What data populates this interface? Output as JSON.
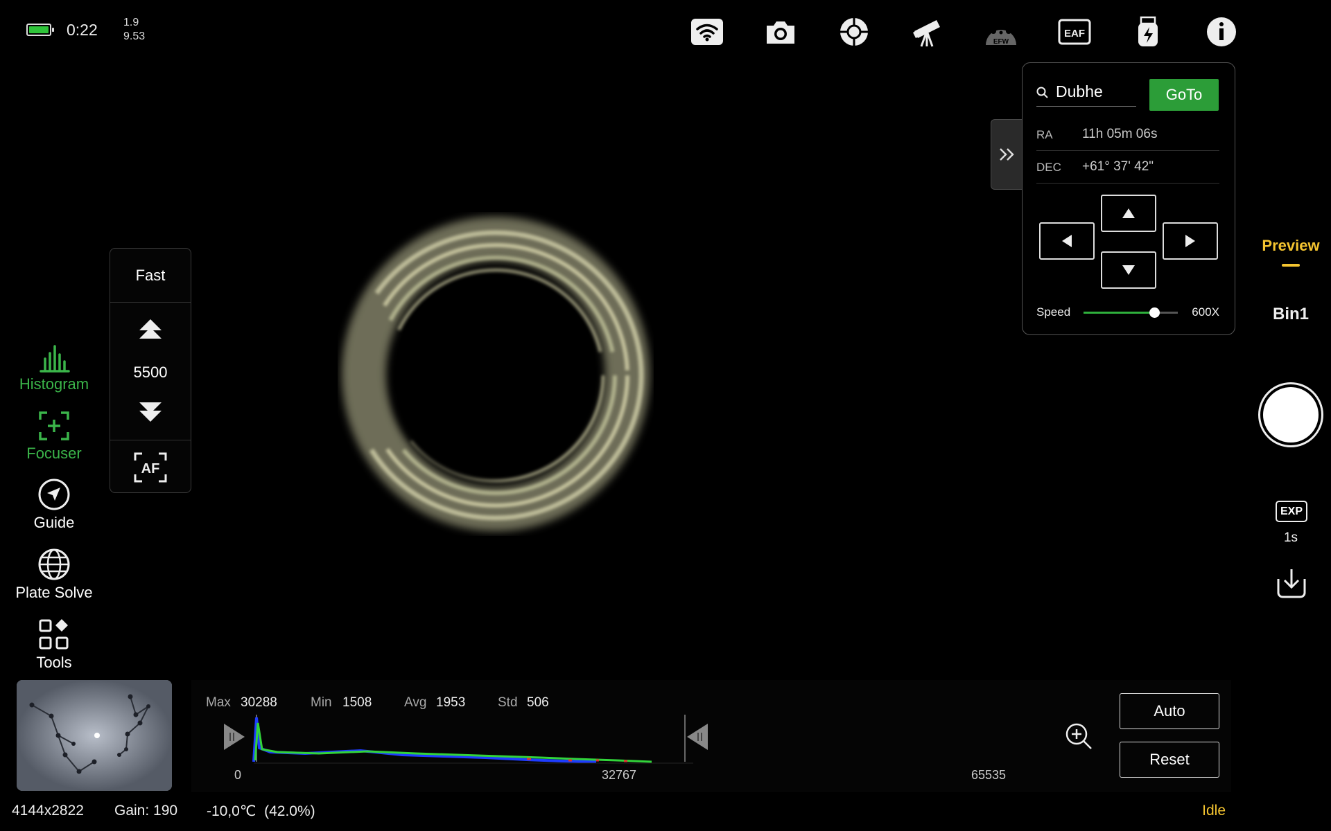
{
  "status": {
    "time": "0:22",
    "value_top": "1.9",
    "value_bottom": "9.53",
    "battery_level": 1.0
  },
  "toolbar": {
    "icons": [
      "wifi-icon",
      "camera-icon",
      "guide-crosshair-icon",
      "telescope-icon",
      "efw-icon",
      "eaf-icon",
      "usb-storage-icon",
      "info-icon"
    ],
    "efw_label": "EFW",
    "eaf_label": "EAF"
  },
  "sidebar": {
    "items": [
      {
        "label": "Histogram",
        "icon": "histogram-icon",
        "active": true
      },
      {
        "label": "Focuser",
        "icon": "focuser-icon",
        "active": true
      },
      {
        "label": "Guide",
        "icon": "guide-icon",
        "active": false
      },
      {
        "label": "Plate Solve",
        "icon": "globe-icon",
        "active": false
      },
      {
        "label": "Tools",
        "icon": "tools-grid-icon",
        "active": false
      }
    ]
  },
  "focuser": {
    "speed": "Fast",
    "position": "5500",
    "af_label": "AF"
  },
  "mount": {
    "search_value": "Dubhe",
    "goto_label": "GoTo",
    "ra_label": "RA",
    "ra_value": "11h 05m 06s",
    "dec_label": "DEC",
    "dec_value": "+61° 37' 42\"",
    "speed_label": "Speed",
    "speed_value": "600X",
    "speed_fraction": 0.75
  },
  "right": {
    "mode": "Preview",
    "bin": "Bin1",
    "exp_badge": "EXP",
    "exposure": "1s"
  },
  "histogram": {
    "max_label": "Max",
    "max": "30288",
    "min_label": "Min",
    "min": "1508",
    "avg_label": "Avg",
    "avg": "1953",
    "std_label": "Std",
    "std": "506",
    "axis": [
      "0",
      "32767",
      "65535"
    ],
    "auto_label": "Auto",
    "reset_label": "Reset"
  },
  "footer": {
    "resolution": "4144x2822",
    "gain": "Gain: 190",
    "temperature": "-10,0℃  (42.0%)",
    "state": "Idle"
  },
  "colors": {
    "accent_green": "#2c9d38",
    "accent_yellow": "#f4c430"
  }
}
